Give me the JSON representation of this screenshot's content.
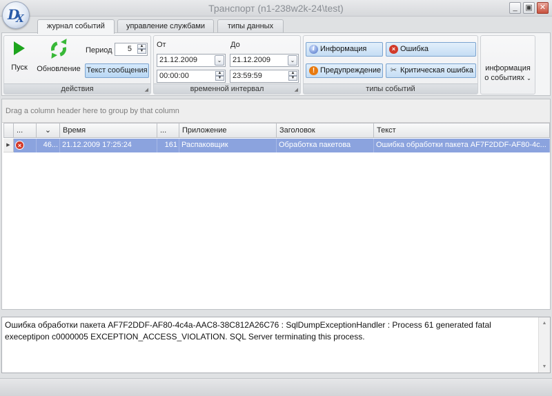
{
  "window": {
    "title": "Транспорт (n1-238w2k-24\\test)",
    "minimize_glyph": "_",
    "maximize_glyph": "▣",
    "close_glyph": "✕"
  },
  "logo": {
    "letter1": "D",
    "letter2": "X"
  },
  "tabs": [
    {
      "label": "журнал событий",
      "active": true
    },
    {
      "label": "управление службами",
      "active": false
    },
    {
      "label": "типы данных",
      "active": false
    }
  ],
  "ribbon": {
    "actions": {
      "caption": "действия",
      "start_label": "Пуск",
      "refresh_label": "Обновление",
      "period_label": "Период",
      "period_value": "5",
      "message_text_button": "Текст сообщения"
    },
    "time_interval": {
      "caption": "временной интервал",
      "from_label": "От",
      "to_label": "До",
      "from_date": "21.12.2009",
      "to_date": "21.12.2009",
      "from_time": "00:00:00",
      "to_time": "23:59:59"
    },
    "event_types": {
      "caption": "типы событий",
      "info": "Информация",
      "error": "Ошибка",
      "warning": "Предупреждение",
      "critical": "Критическая ошибка"
    },
    "event_info": {
      "line1": "информация",
      "line2": "о событиях"
    }
  },
  "grid": {
    "group_panel_text": "Drag a column header here to group by that column",
    "headers": [
      "...",
      "",
      "Время",
      "...",
      "Приложение",
      "Заголовок",
      "Текст"
    ],
    "sort_glyph": "⌄",
    "rows": [
      {
        "type": "error",
        "id": "46...",
        "time": "21.12.2009 17:25:24",
        "count": "161",
        "application": "Распаковщик",
        "header": "Обработка пакетова",
        "text": "Ошибка обработки пакета AF7F2DDF-AF80-4c..."
      }
    ]
  },
  "detail": {
    "message": "Ошибка обработки пакета AF7F2DDF-AF80-4c4a-AAC8-38C812A26C76 : SqlDumpExceptionHandler : Process 61 generated fatal execeptipon c0000005 EXCEPTION_ACCESS_VIOLATION. SQL Server terminating this process."
  },
  "colors": {
    "selected_row": "#8ba3de",
    "event_button": "#c5ddf4",
    "start_icon": "#1ea51e",
    "error_icon": "#d23a2a"
  },
  "icons": {
    "start": "play-icon",
    "refresh": "refresh-icon",
    "info": "info-icon",
    "error": "error-icon",
    "warning": "warning-icon",
    "critical": "critical-error-icon"
  }
}
